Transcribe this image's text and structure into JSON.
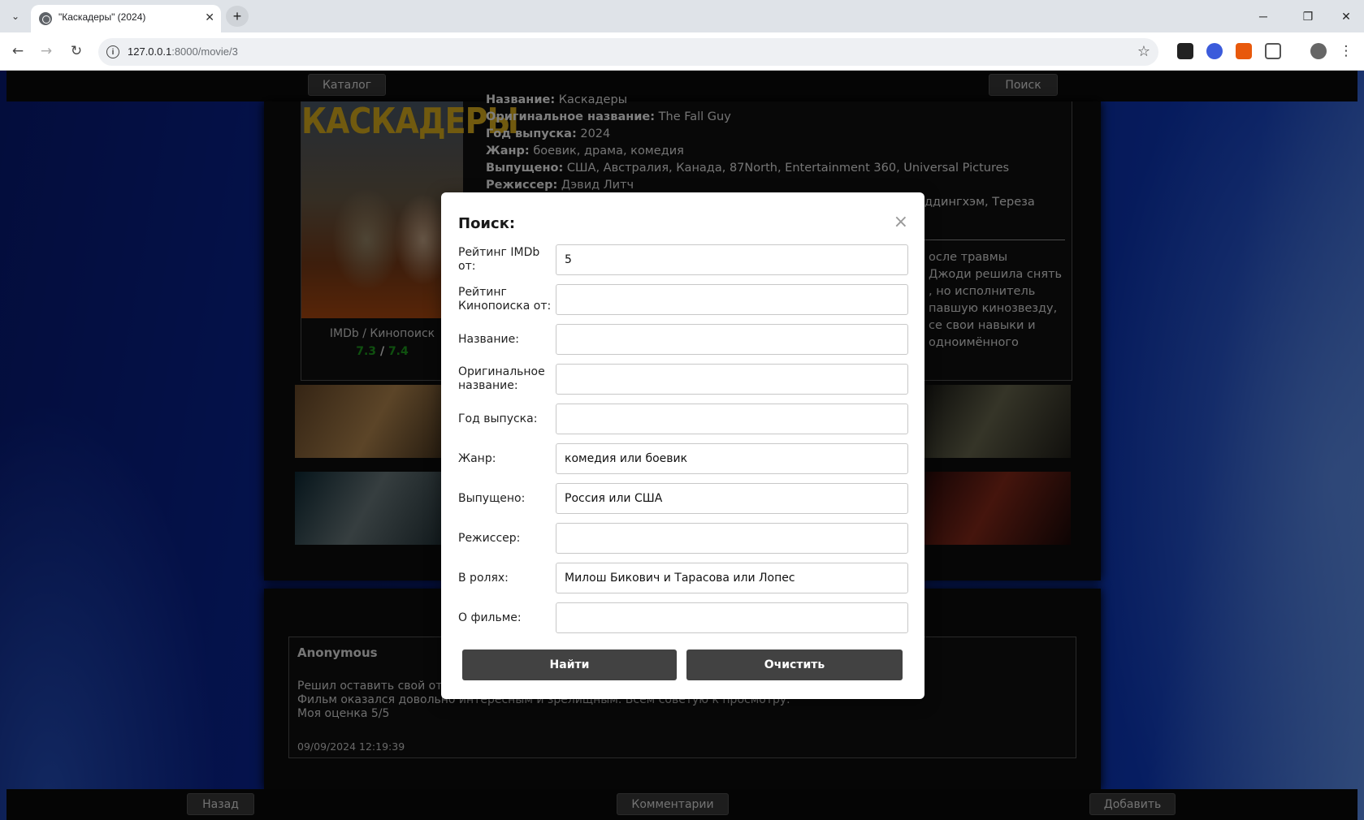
{
  "browser": {
    "tab_title": "\"Каскадеры\" (2024)",
    "url_host": "127.0.0.1",
    "url_rest": ":8000/movie/3"
  },
  "nav": {
    "catalog": "Каталог",
    "search": "Поиск",
    "back": "Назад",
    "comments": "Комментарии",
    "add": "Добавить"
  },
  "movie": {
    "poster_title": "КАСКАДЕРЫ",
    "ratings_label": "IMDb / Кинопоиск",
    "imdb": "7.3",
    "kp": "7.4",
    "ratings_sep": "/",
    "fields": [
      {
        "label": "Название:",
        "value": "Каскадеры"
      },
      {
        "label": "Оригинальное название:",
        "value": "The Fall Guy"
      },
      {
        "label": "Год выпуска:",
        "value": "2024"
      },
      {
        "label": "Жанр:",
        "value": "боевик, драма, комедия"
      },
      {
        "label": "Выпущено:",
        "value": "США, Австралия, Канада, 87North, Entertainment 360, Universal Pictures"
      },
      {
        "label": "Режиссер:",
        "value": "Дэвид Литч"
      }
    ],
    "cast_tail": "ддингхэм, Тереза",
    "desc_lines": [
      "осле травмы",
      "Джоди решила снять",
      ", но исполнитель",
      "павшую кинозвезду,",
      "се свои навыки и",
      "одноимённого"
    ]
  },
  "comment": {
    "author": "Anonymous",
    "line1": "Решил оставить свой отз",
    "line2": "Фильм оказался довольно интересным и зрелищным. Всем советую к просмотру.",
    "line3": "Моя оценка 5/5",
    "date": "09/09/2024 12:19:39"
  },
  "modal": {
    "title": "Поиск:",
    "close": "×",
    "fields": [
      {
        "label": "Рейтинг IMDb от:",
        "value": ""
      },
      {
        "label": "Рейтинг Кинопоиска от:",
        "value": ""
      },
      {
        "label": "Название:",
        "value": ""
      },
      {
        "label": "Оригинальное название:",
        "value": ""
      },
      {
        "label": "Год выпуска:",
        "value": ""
      },
      {
        "label": "Жанр:",
        "value": "комедия или боевик"
      },
      {
        "label": "Выпущено:",
        "value": "Россия или США"
      },
      {
        "label": "Режиссер:",
        "value": ""
      },
      {
        "label": "В ролях:",
        "value": "Милош Бикович и Тарасова или Лопес"
      },
      {
        "label": "О фильме:",
        "value": ""
      }
    ],
    "imdb_value": "5",
    "find": "Найти",
    "clear": "Очистить"
  }
}
